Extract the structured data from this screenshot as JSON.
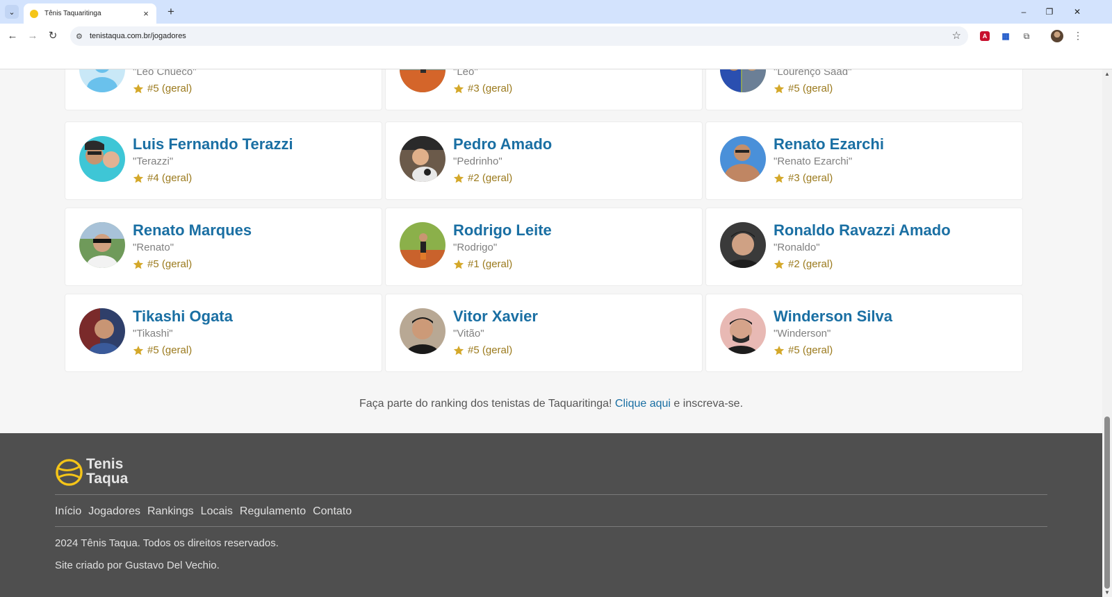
{
  "browser": {
    "tab_title": "Tênis Taquaritinga",
    "url": "tenistaqua.com.br/jogadores",
    "close_glyph": "×",
    "new_tab_glyph": "+",
    "minimize_glyph": "–",
    "restore_glyph": "❐",
    "close_window_glyph": "✕",
    "extensions": [
      "pdf-extension-icon",
      "grid-extension-icon",
      "puzzle-icon"
    ]
  },
  "players": [
    {
      "name": "",
      "nickname": "\"Leo Chueco\"",
      "rank": "#5 (geral)",
      "avatar": "default-avatar"
    },
    {
      "name": "",
      "nickname": "\"Léo\"",
      "rank": "#3 (geral)",
      "avatar": "photo-orange"
    },
    {
      "name": "",
      "nickname": "\"Lourenço Saad\"",
      "rank": "#5 (geral)",
      "avatar": "photo-blue"
    },
    {
      "name": "Luis Fernando Terazzi",
      "nickname": "\"Terazzi\"",
      "rank": "#4 (geral)",
      "avatar": "photo"
    },
    {
      "name": "Pedro Amado",
      "nickname": "\"Pedrinho\"",
      "rank": "#2 (geral)",
      "avatar": "photo"
    },
    {
      "name": "Renato Ezarchi",
      "nickname": "\"Renato Ezarchi\"",
      "rank": "#3 (geral)",
      "avatar": "photo"
    },
    {
      "name": "Renato Marques",
      "nickname": "\"Renato\"",
      "rank": "#5 (geral)",
      "avatar": "photo"
    },
    {
      "name": "Rodrigo Leite",
      "nickname": "\"Rodrigo\"",
      "rank": "#1 (geral)",
      "avatar": "photo"
    },
    {
      "name": "Ronaldo Ravazzi Amado",
      "nickname": "\"Ronaldo\"",
      "rank": "#2 (geral)",
      "avatar": "photo"
    },
    {
      "name": "Tikashi Ogata",
      "nickname": "\"Tikashi\"",
      "rank": "#5 (geral)",
      "avatar": "photo"
    },
    {
      "name": "Vitor Xavier",
      "nickname": "\"Vitão\"",
      "rank": "#5 (geral)",
      "avatar": "photo"
    },
    {
      "name": "Winderson Silva",
      "nickname": "\"Winderson\"",
      "rank": "#5 (geral)",
      "avatar": "photo"
    }
  ],
  "cta": {
    "prefix": "Faça parte do ranking dos tenistas de Taquaritinga! ",
    "link": "Clique aqui",
    "suffix": " e inscreva-se."
  },
  "footer": {
    "logo_line1": "Tenis",
    "logo_line2": "Taqua",
    "nav": [
      "Início",
      "Jogadores",
      "Rankings",
      "Locais",
      "Regulamento",
      "Contato"
    ],
    "copyright": "2024 Tênis Taqua. Todos os direitos reservados.",
    "credit": "Site criado por Gustavo Del Vechio."
  },
  "colors": {
    "name": "#1a6fa3",
    "rank": "#9b7a1d",
    "star": "#d4a82a",
    "footer_bg": "#4f4f4f",
    "logo_yellow": "#f5c518"
  }
}
